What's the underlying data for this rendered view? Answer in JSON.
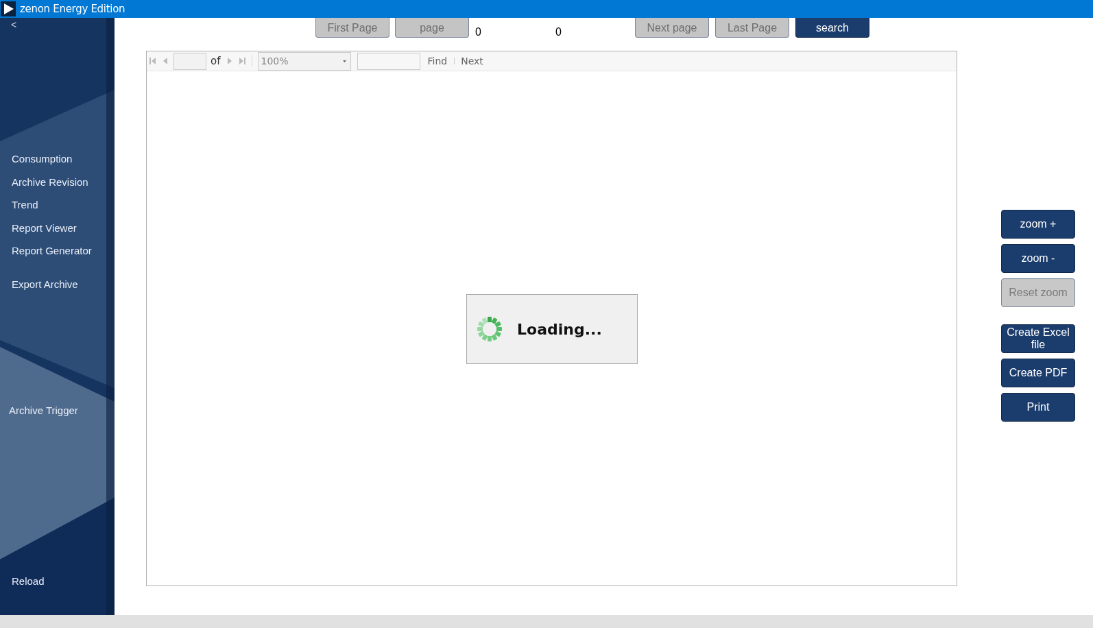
{
  "window": {
    "title": "zenon Energy Edition"
  },
  "sidebar": {
    "collapse": "<",
    "groups": [
      {
        "items": [
          "Consumption",
          "Archive Revision",
          "Trend",
          "Report Viewer",
          "Report Generator"
        ]
      },
      {
        "items": [
          "Export Archive"
        ]
      },
      {
        "items": [
          "Archive Trigger"
        ]
      },
      {
        "items": [
          "Reload"
        ]
      }
    ]
  },
  "paging": {
    "buttons_left": [
      {
        "label": "First Page",
        "disabled": true
      },
      {
        "label": "page",
        "disabled": true
      }
    ],
    "values": [
      "0",
      "0"
    ],
    "buttons_right": [
      {
        "label": "Next page",
        "disabled": true
      },
      {
        "label": "Last Page",
        "disabled": true
      },
      {
        "label": "search",
        "disabled": false
      }
    ]
  },
  "viewer": {
    "toolbar": {
      "page_of": "of",
      "zoom": "100%",
      "find": "Find",
      "next": "Next"
    },
    "loading": "Loading..."
  },
  "side_buttons": {
    "zoom": [
      {
        "label": "zoom +",
        "disabled": false
      },
      {
        "label": "zoom -",
        "disabled": false
      },
      {
        "label": "Reset zoom",
        "disabled": true
      }
    ],
    "export": [
      {
        "label": "Create Excel file",
        "disabled": false
      },
      {
        "label": "Create PDF",
        "disabled": false
      },
      {
        "label": "Print",
        "disabled": false
      }
    ]
  }
}
